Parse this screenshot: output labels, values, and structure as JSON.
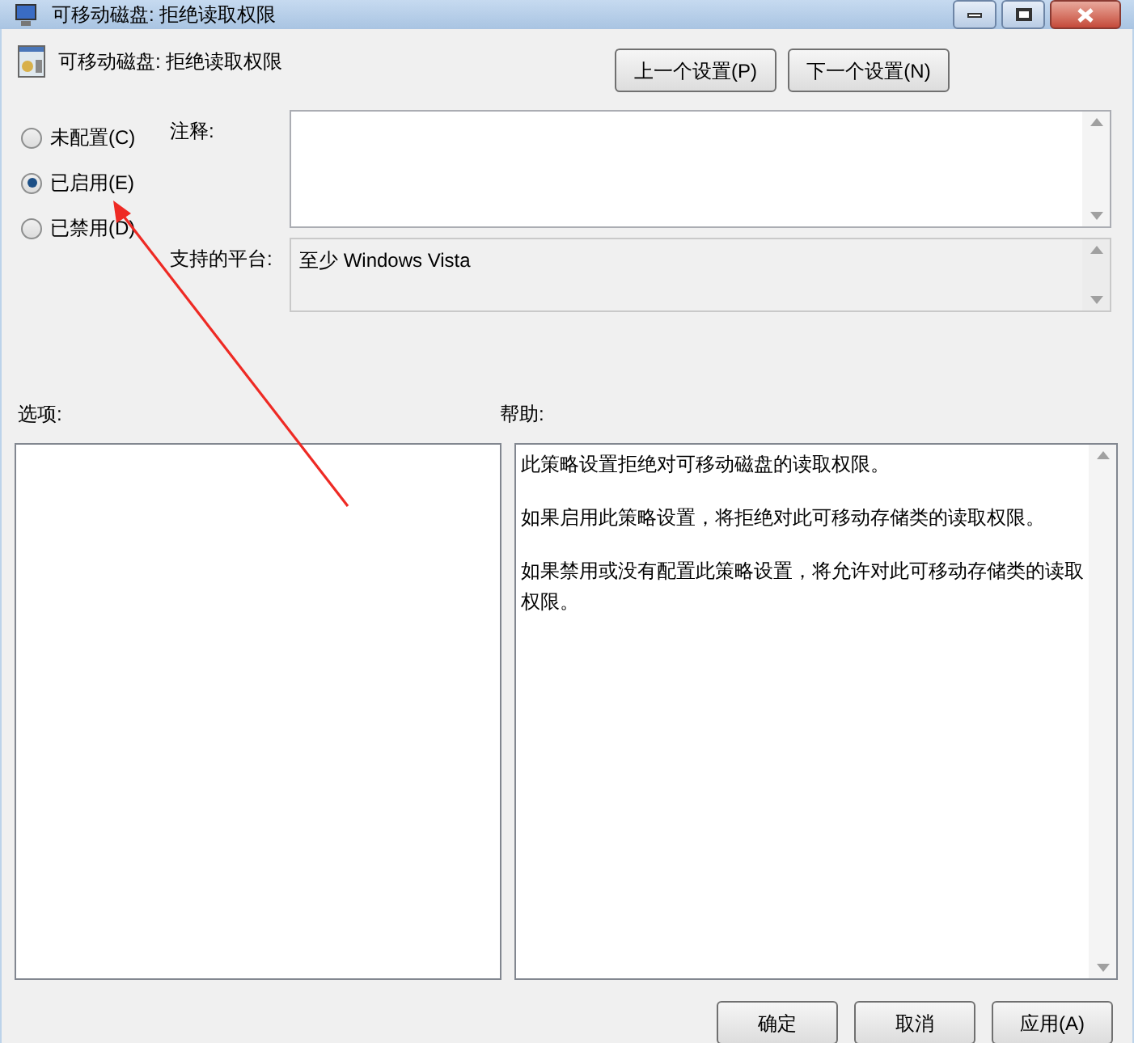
{
  "window": {
    "title": "可移动磁盘: 拒绝读取权限"
  },
  "header": {
    "title": "可移动磁盘: 拒绝读取权限",
    "buttons": [
      "上一个设置(P)",
      "下一个设置(N)"
    ]
  },
  "state_options": [
    {
      "label": "未配置(C)",
      "selected": false
    },
    {
      "label": "已启用(E)",
      "selected": true
    },
    {
      "label": "已禁用(D)",
      "selected": false
    }
  ],
  "comment": {
    "label": "注释:"
  },
  "platform": {
    "label": "支持的平台:",
    "value": "至少 Windows Vista"
  },
  "options": {
    "label": "选项:"
  },
  "help": {
    "label": "帮助:",
    "paragraphs": [
      "此策略设置拒绝对可移动磁盘的读取权限。",
      "如果启用此策略设置，将拒绝对此可移动存储类的读取权限。",
      "如果禁用或没有配置此策略设置，将允许对此可移动存储类的读取权限。"
    ]
  },
  "buttons": [
    "确定",
    "取消",
    "应用(A)"
  ]
}
